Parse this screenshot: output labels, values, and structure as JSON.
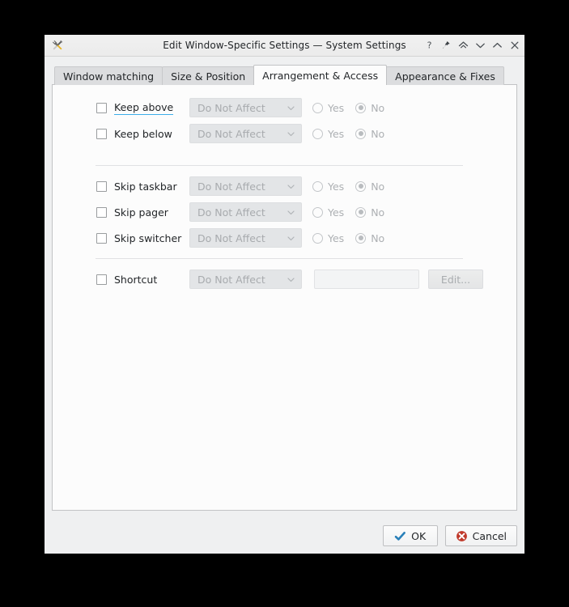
{
  "window": {
    "title": "Edit Window-Specific Settings — System Settings",
    "app_icon": "tools-icon",
    "titlebar_buttons": [
      {
        "name": "help-button",
        "glyph": "?"
      },
      {
        "name": "keep-above-pin-button",
        "glyph": "pin"
      },
      {
        "name": "shade-button",
        "glyph": "double-chevron-up"
      },
      {
        "name": "minimize-button",
        "glyph": "chevron-down"
      },
      {
        "name": "maximize-button",
        "glyph": "chevron-up"
      },
      {
        "name": "close-button",
        "glyph": "x"
      }
    ]
  },
  "tabs": [
    {
      "label": "Window matching",
      "active": false
    },
    {
      "label": "Size & Position",
      "active": false
    },
    {
      "label": "Arrangement & Access",
      "active": true
    },
    {
      "label": "Appearance & Fixes",
      "active": false
    }
  ],
  "form": {
    "combo_value": "Do Not Affect",
    "radio_yes": "Yes",
    "radio_no": "No",
    "rows": [
      {
        "id": "keep-above",
        "label": "Keep above",
        "checked": false,
        "hovered": true,
        "combo": "Do Not Affect",
        "yes": false,
        "no": true
      },
      {
        "id": "keep-below",
        "label": "Keep below",
        "checked": false,
        "hovered": false,
        "combo": "Do Not Affect",
        "yes": false,
        "no": true
      },
      {
        "id": "skip-taskbar",
        "label": "Skip taskbar",
        "checked": false,
        "hovered": false,
        "combo": "Do Not Affect",
        "yes": false,
        "no": true
      },
      {
        "id": "skip-pager",
        "label": "Skip pager",
        "checked": false,
        "hovered": false,
        "combo": "Do Not Affect",
        "yes": false,
        "no": true
      },
      {
        "id": "skip-switcher",
        "label": "Skip switcher",
        "checked": false,
        "hovered": false,
        "combo": "Do Not Affect",
        "yes": false,
        "no": true
      }
    ],
    "shortcut": {
      "label": "Shortcut",
      "checked": false,
      "combo": "Do Not Affect",
      "field_value": "",
      "edit_label": "Edit..."
    }
  },
  "footer": {
    "ok_label": "OK",
    "cancel_label": "Cancel"
  },
  "colors": {
    "accent": "#3daee9",
    "window_bg": "#eff0f1",
    "panel_bg": "#fcfcfc",
    "ok_check": "#2980b9",
    "cancel_red": "#c0392b"
  }
}
